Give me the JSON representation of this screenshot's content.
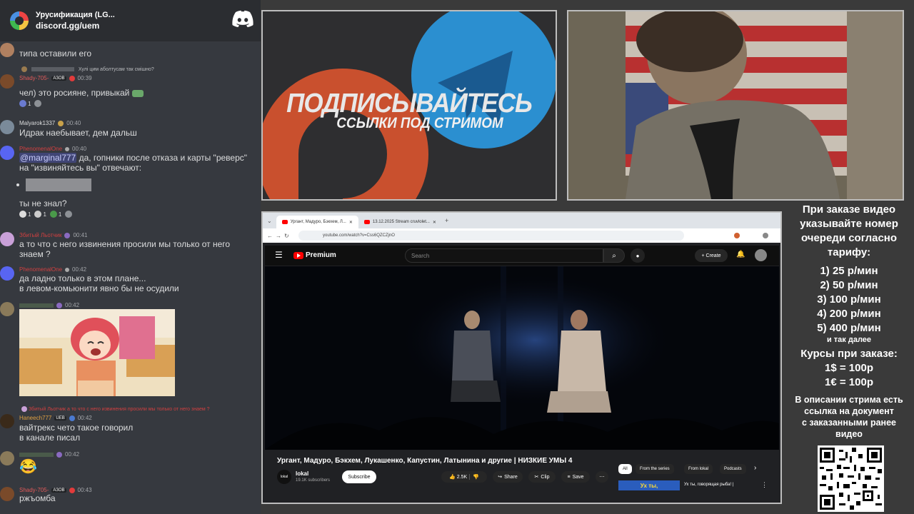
{
  "chat": {
    "server_name": "Урусификация (LG...",
    "invite": "discord.gg/uem",
    "messages": [
      {
        "text": "типа оставили его"
      },
      {
        "reply": "Хулі цим аболтусам так смішно?",
        "username": "Shady-705-",
        "tag": "АЗОВ",
        "time": "00:39",
        "text": "чел) это росияне, привыкай",
        "reactions": [
          "1"
        ]
      },
      {
        "username": "Malyarok1337",
        "time": "00:40",
        "text": "Идрак наебывает, дем дальш"
      },
      {
        "username": "PhenomenalOne",
        "time": "00:40",
        "mention": "@marginal777",
        "text": " да, гопники после отказа и карты \"реверс\" на \"извиняйтесь вы\" отвечают:",
        "text2": "ты не знал?",
        "reactions": [
          "1",
          "1",
          "1"
        ]
      },
      {
        "username": "Збитый Льотчик",
        "time": "00:41",
        "text": "а то что с него извинения просили мы только от него знаем ?"
      },
      {
        "username": "PhenomenalOne",
        "time": "00:42",
        "text": "да ладно только в этом плане...",
        "text2": "в левом-комьюнити явно бы не осудили"
      },
      {
        "time": "00:42"
      },
      {
        "reply": "Збитый Льотчик а то что с него извинения просили мы только от него знаем ?",
        "username": "Haneech777",
        "tag": "UEB",
        "time": "00:42",
        "text": "вайтрекс чето такое говорил",
        "text2": "в канале писал"
      },
      {
        "time": "00:42",
        "text": "😂"
      },
      {
        "username": "Shady-705-",
        "tag": "АЗОВ",
        "time": "00:43",
        "text": "ржъомба"
      }
    ]
  },
  "promo": {
    "title": "ПОДПИСЫВАЙТЕСЬ",
    "subtitle": "ССЫЛКИ ПОД СТРИМОМ"
  },
  "browser": {
    "tab1": "Ургант, Мадуро, Бэкхем, Л...",
    "tab2": "13.12.2025 Stream cruvlolet...",
    "url": "youtube.com/watch?v=Css6QZCZjnO",
    "yt_logo": "Premium",
    "search_placeholder": "Search",
    "create": "Create",
    "video_title": "Ургант, Мадуро, Бэкхем, Лукашенко, Капустин, Латынина и другие | НИЗКИЕ УМЫ 4",
    "channel_avatar": "lokal",
    "channel": "lokal",
    "subscribers": "19.1K subscribers",
    "subscribe": "Subscribe",
    "likes": "2.5K",
    "share": "Share",
    "clip": "Clip",
    "save": "Save",
    "chips": [
      "All",
      "From the series",
      "From lokal",
      "Podcasts"
    ],
    "related_thumb": "Ух ты,",
    "related_title": "Ух ты, говорящая рыба! |"
  },
  "info": {
    "order_note": [
      "При заказе видео",
      "указывайте номер",
      "очереди согласно",
      "тарифу:"
    ],
    "tariffs": [
      "1) 25 р/мин",
      "2) 50 р/мин",
      "3) 100 р/мин",
      "4) 200 р/мин",
      "5) 400 р/мин"
    ],
    "etc": "и так далее",
    "rates_title": "Курсы при заказе:",
    "rates": [
      "1$ = 100р",
      "1€ = 100р"
    ],
    "description_note": [
      "В описании стрима есть",
      "ссылка на документ",
      "с заказанными ранее",
      "видео"
    ]
  },
  "colors": {
    "chat_bg": "#36393f",
    "promo_red": "#d4502a",
    "promo_blue": "#2a9ad8",
    "discord_blurple": "#5865f2"
  }
}
